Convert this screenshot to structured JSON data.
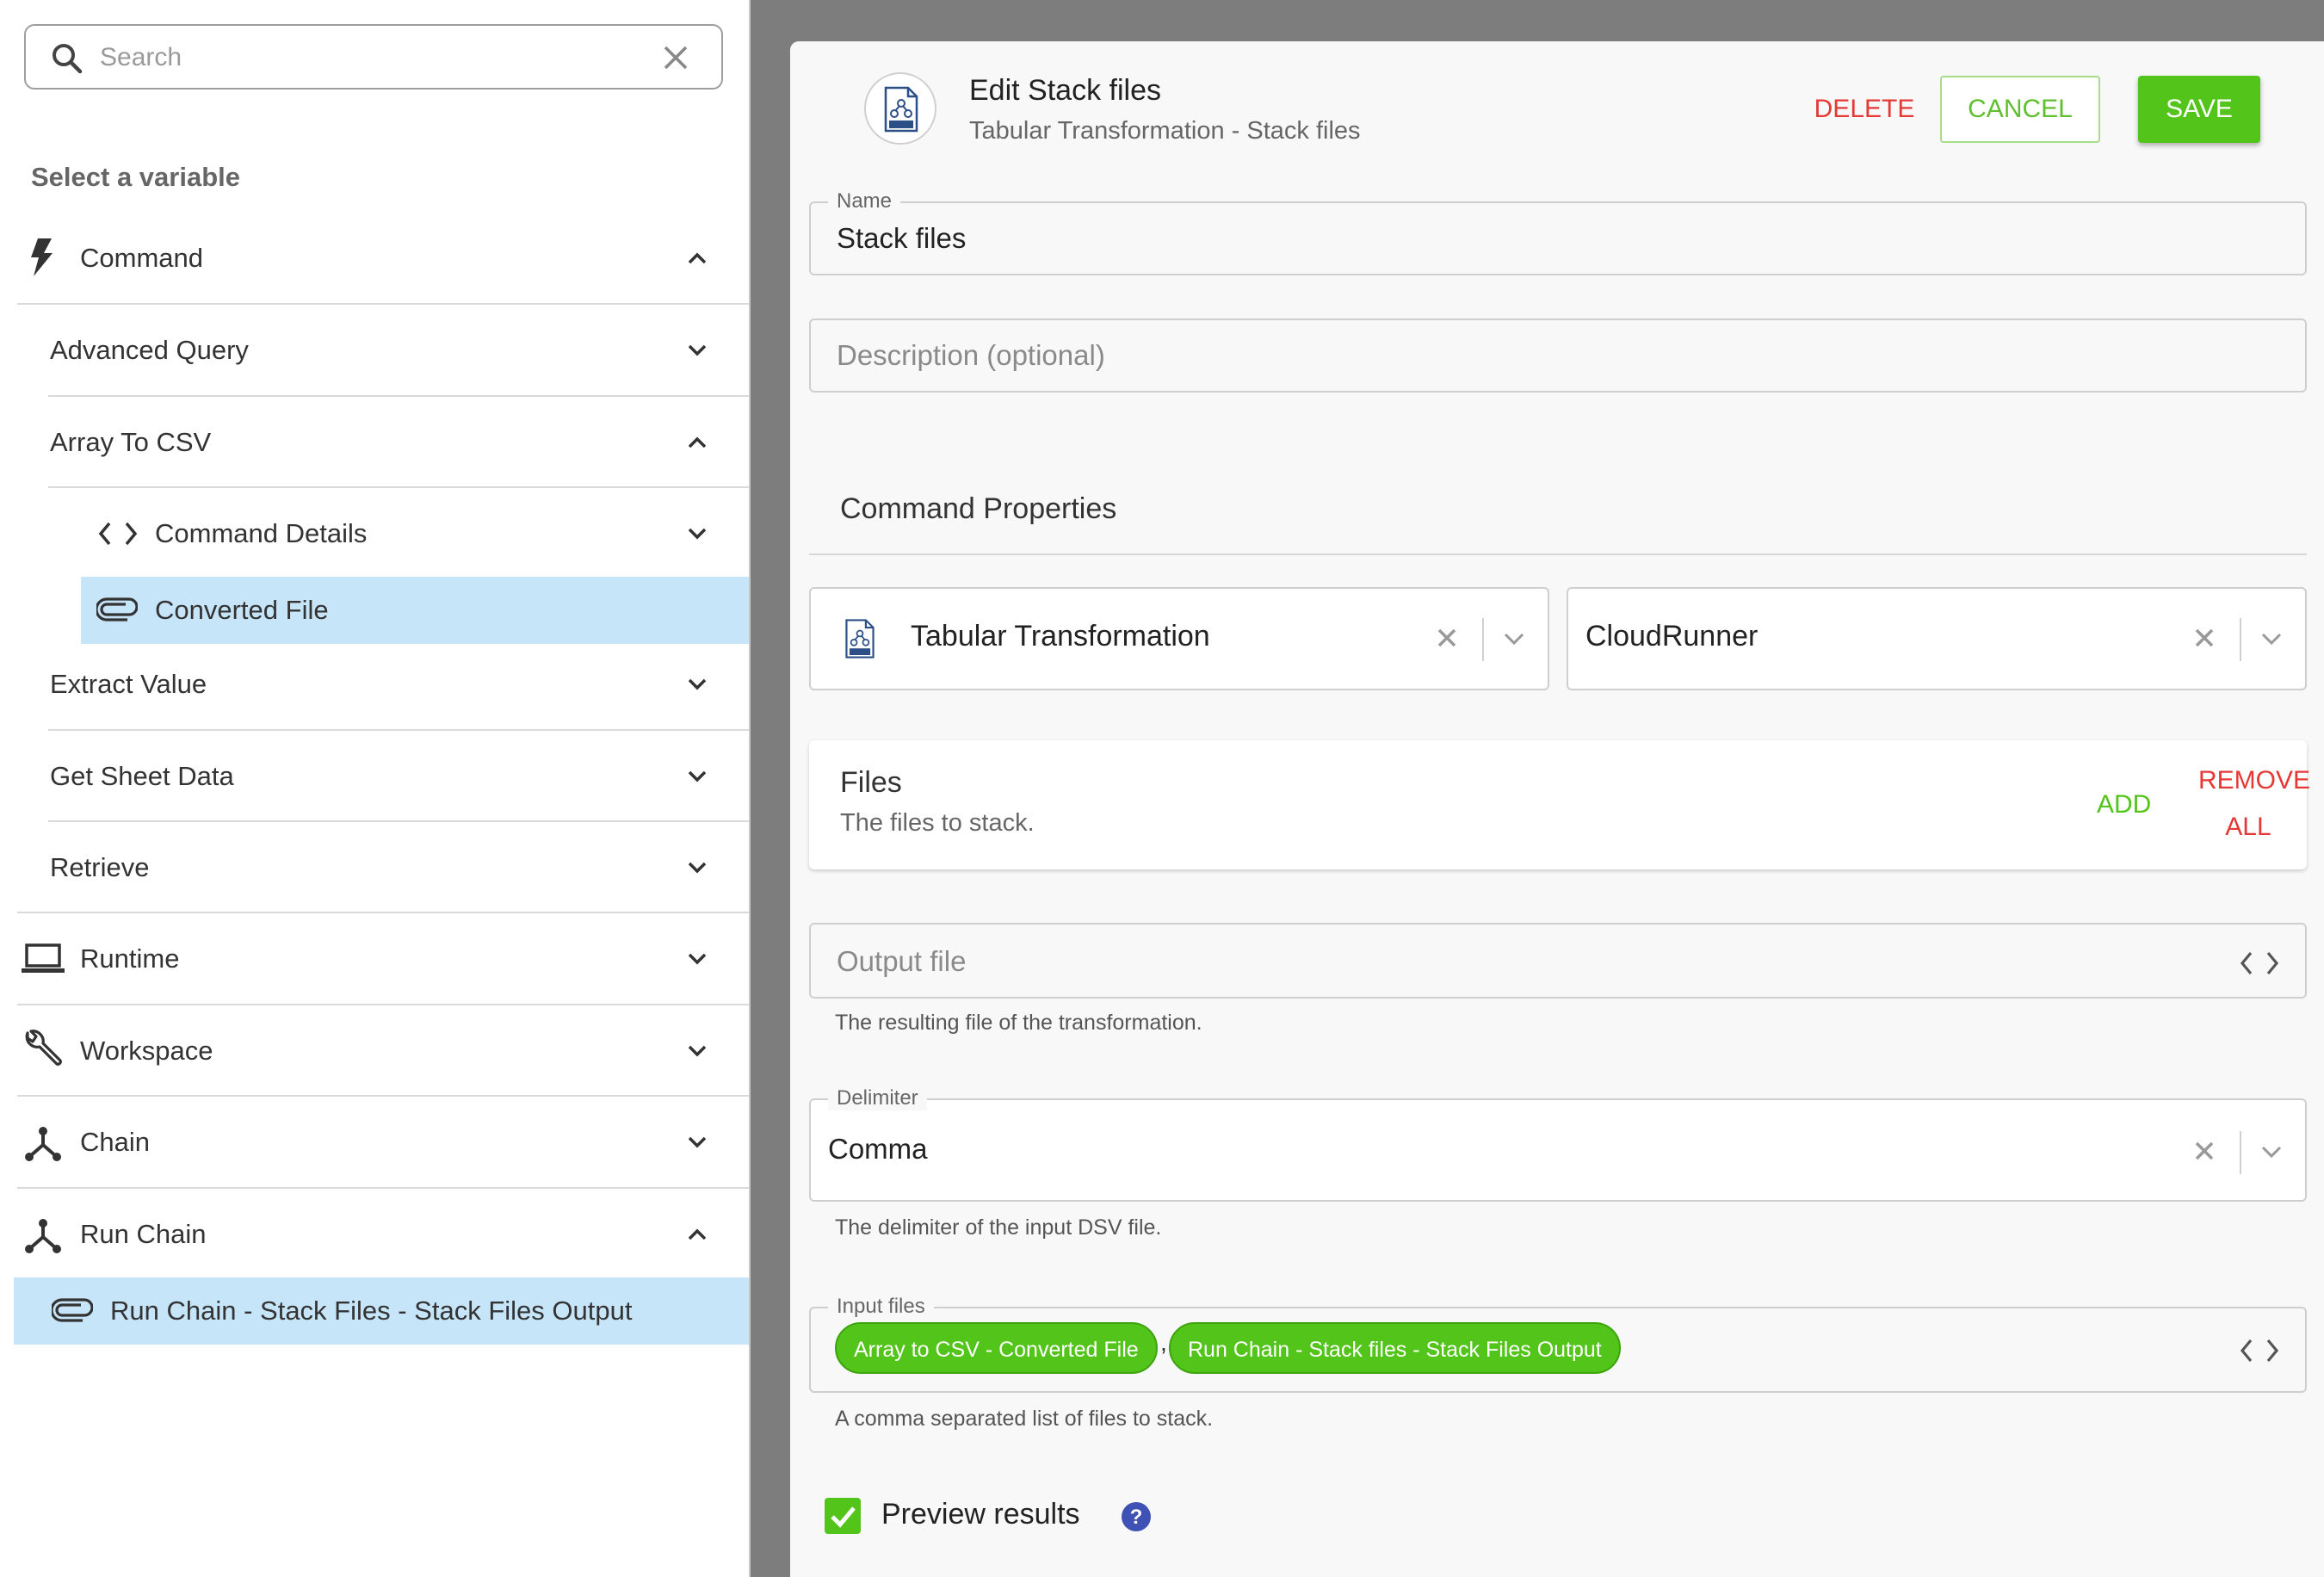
{
  "search": {
    "placeholder": "Search",
    "value": ""
  },
  "sidebar": {
    "heading": "Select a variable",
    "items": [
      {
        "label": "Command",
        "icon": "bolt-icon",
        "expanded": true
      },
      {
        "label": "Advanced Query",
        "expanded": false
      },
      {
        "label": "Array To CSV",
        "expanded": true
      },
      {
        "label": "Command Details",
        "icon": "code-icon",
        "expanded": false
      },
      {
        "label": "Converted File",
        "icon": "paperclip-icon",
        "selected": true
      },
      {
        "label": "Extract Value",
        "expanded": false
      },
      {
        "label": "Get Sheet Data",
        "expanded": false
      },
      {
        "label": "Retrieve",
        "expanded": false
      },
      {
        "label": "Runtime",
        "icon": "laptop-icon",
        "expanded": false
      },
      {
        "label": "Workspace",
        "icon": "wrench-icon",
        "expanded": false
      },
      {
        "label": "Chain",
        "icon": "fork-icon",
        "expanded": false
      },
      {
        "label": "Run Chain",
        "icon": "fork-icon",
        "expanded": true
      },
      {
        "label": "Run Chain - Stack Files - Stack Files Output",
        "icon": "paperclip-icon",
        "selected": true
      }
    ]
  },
  "panel": {
    "title": "Edit Stack files",
    "subtitle": "Tabular Transformation - Stack files",
    "buttons": {
      "delete": "DELETE",
      "cancel": "CANCEL",
      "save": "SAVE"
    },
    "name": {
      "label": "Name",
      "value": "Stack files"
    },
    "description": {
      "placeholder": "Description (optional)"
    },
    "command_properties": {
      "title": "Command Properties",
      "command_select": {
        "value": "Tabular Transformation",
        "icon": "file-tab-icon"
      },
      "runner_select": {
        "value": "CloudRunner"
      }
    },
    "files": {
      "title": "Files",
      "description": "The files to stack.",
      "add_label": "ADD",
      "remove_all_label": "REMOVE ALL"
    },
    "output_file": {
      "placeholder": "Output file",
      "helper": "The resulting file of the transformation."
    },
    "delimiter": {
      "label": "Delimiter",
      "value": "Comma",
      "helper": "The delimiter of the input DSV file."
    },
    "input_files": {
      "label": "Input files",
      "chips": [
        "Array to CSV - Converted File",
        "Run Chain - Stack files - Stack Files Output"
      ],
      "separator": ",",
      "helper": "A comma separated list of files to stack."
    },
    "preview": {
      "label": "Preview results",
      "checked": true
    }
  },
  "colors": {
    "accent_green": "#52c41a",
    "danger_red": "#e53935",
    "selected_row_bg": "#c7e5f9",
    "help_icon": "#3f51b5"
  }
}
